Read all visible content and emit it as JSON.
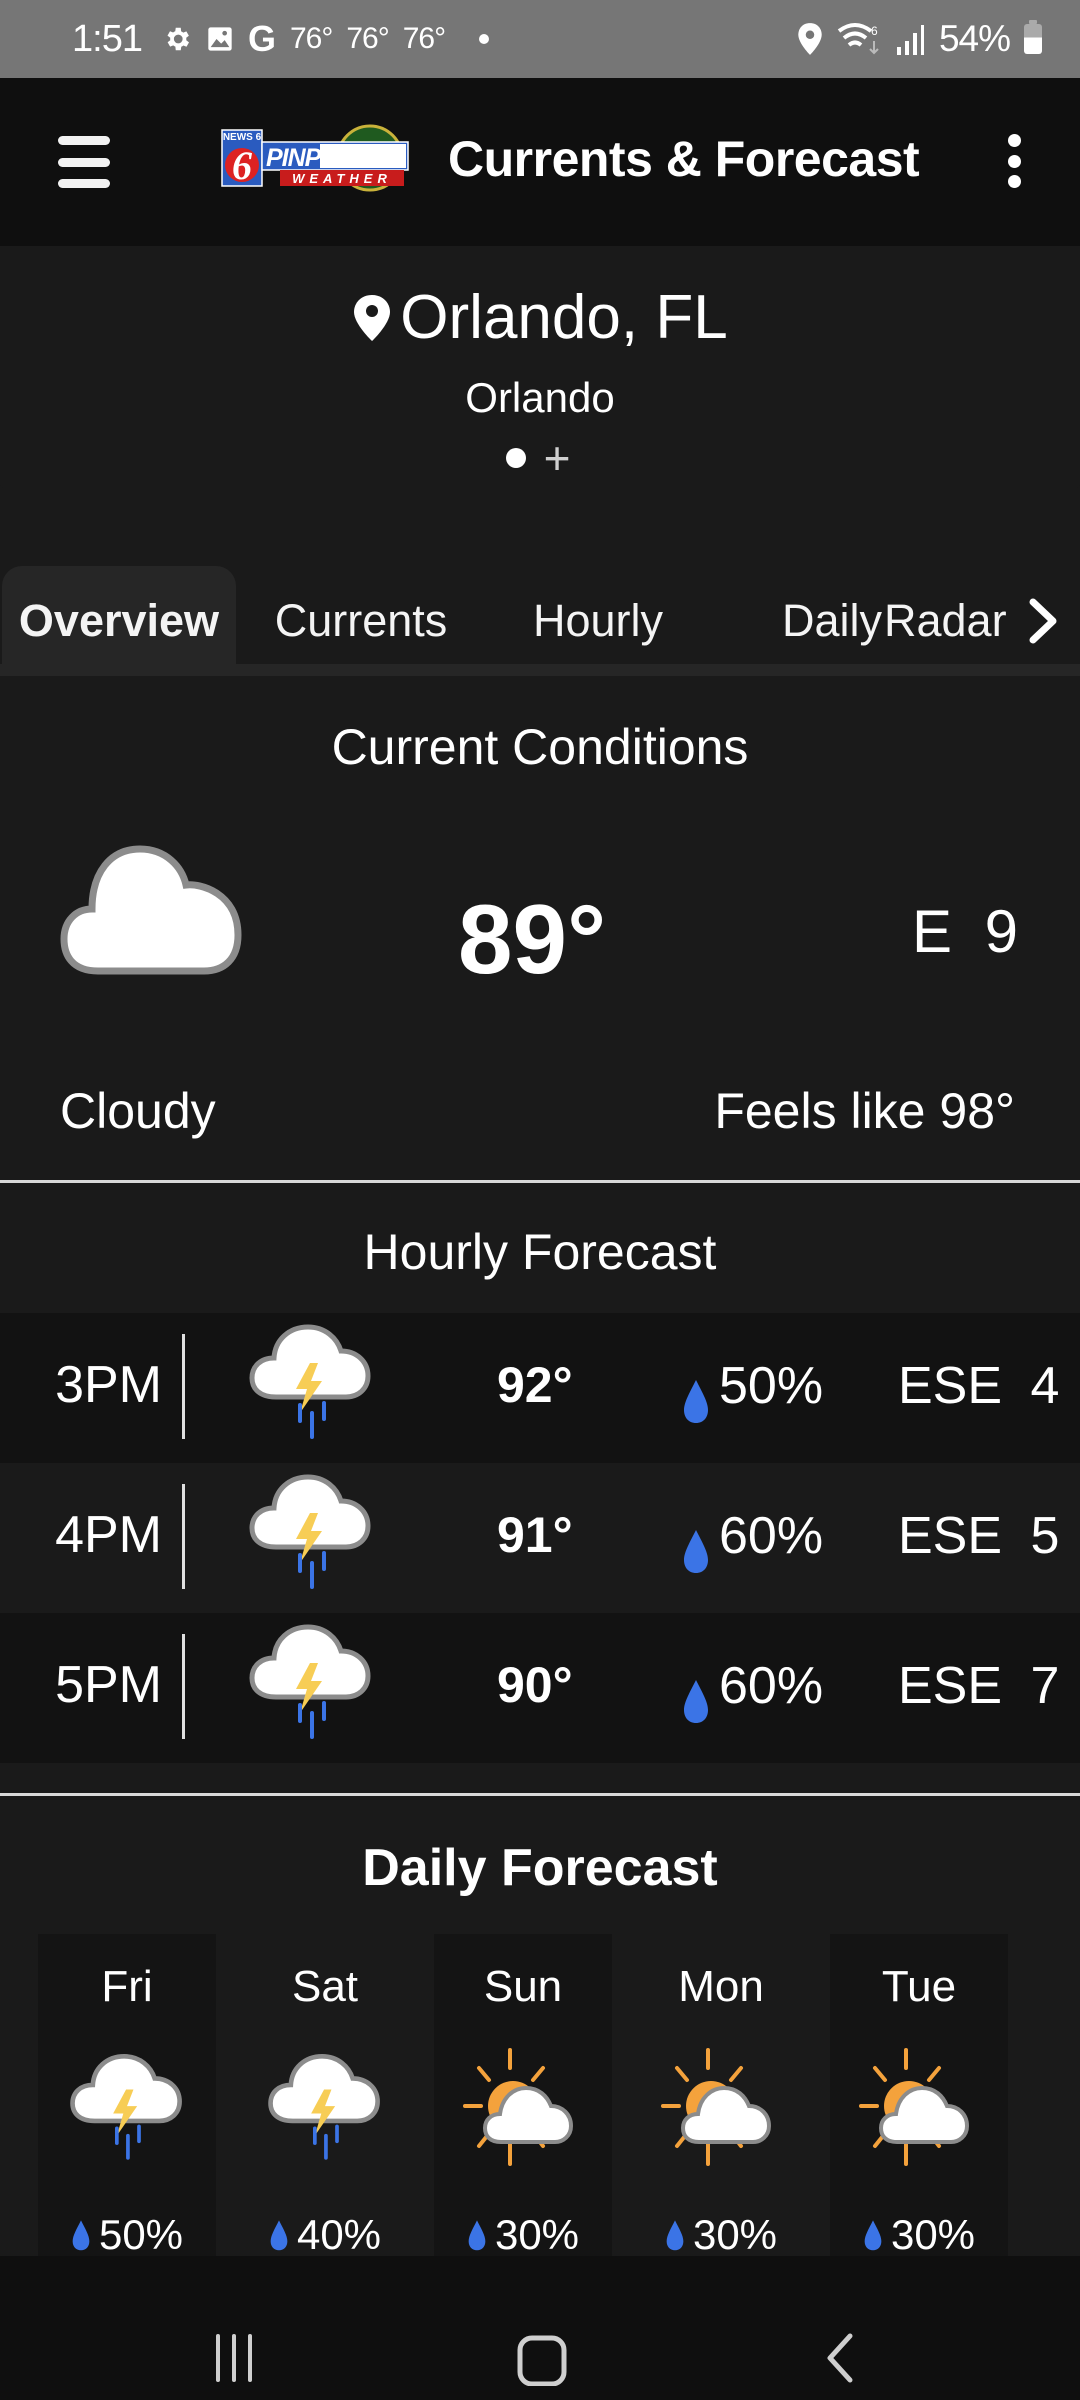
{
  "status_bar": {
    "time": "1:51",
    "temps": [
      "76°",
      "76°",
      "76°"
    ],
    "battery": "54%",
    "icons": [
      "gear-icon",
      "image-icon",
      "google-icon",
      "notification-dot",
      "location-icon",
      "wifi-icon",
      "signal-icon",
      "battery-icon"
    ]
  },
  "app_bar": {
    "title": "Currents & Forecast",
    "logo": {
      "top": "NEWS 6",
      "main": "PINPOINT",
      "sub": "WEATHER"
    },
    "menu_icon": "hamburger-icon",
    "overflow_icon": "more-vert-icon"
  },
  "location": {
    "name": "Orlando, FL",
    "subtitle": "Orlando",
    "add_label": "+"
  },
  "tabs": [
    {
      "label": "Overview",
      "active": true
    },
    {
      "label": "Currents",
      "active": false
    },
    {
      "label": "Hourly",
      "active": false
    },
    {
      "label": "Daily",
      "active": false
    },
    {
      "label": "Radar",
      "active": false
    }
  ],
  "current": {
    "title": "Current Conditions",
    "icon": "cloudy-icon",
    "temperature": "89°",
    "wind": "E 9",
    "condition": "Cloudy",
    "feels_like": "Feels like 98°"
  },
  "hourly": {
    "title": "Hourly Forecast",
    "rows": [
      {
        "time": "3PM",
        "icon": "thunderstorm-icon",
        "temp": "92°",
        "precip": "50%",
        "wind": "ESE 4"
      },
      {
        "time": "4PM",
        "icon": "thunderstorm-icon",
        "temp": "91°",
        "precip": "60%",
        "wind": "ESE 5"
      },
      {
        "time": "5PM",
        "icon": "thunderstorm-icon",
        "temp": "90°",
        "precip": "60%",
        "wind": "ESE 7"
      }
    ]
  },
  "daily": {
    "title": "Daily Forecast",
    "days": [
      {
        "day": "Fri",
        "icon": "thunderstorm-icon",
        "precip": "50%"
      },
      {
        "day": "Sat",
        "icon": "thunderstorm-icon",
        "precip": "40%"
      },
      {
        "day": "Sun",
        "icon": "partly-sunny-icon",
        "precip": "30%"
      },
      {
        "day": "Mon",
        "icon": "partly-sunny-icon",
        "precip": "30%"
      },
      {
        "day": "Tue",
        "icon": "partly-sunny-icon",
        "precip": "30%"
      }
    ]
  },
  "colors": {
    "background": "#1a1a1a",
    "app_bar": "#0f0f0f",
    "rain_blue": "#3b74e6",
    "bolt_yellow": "#f7cd55",
    "sun_orange": "#f4a23c"
  }
}
